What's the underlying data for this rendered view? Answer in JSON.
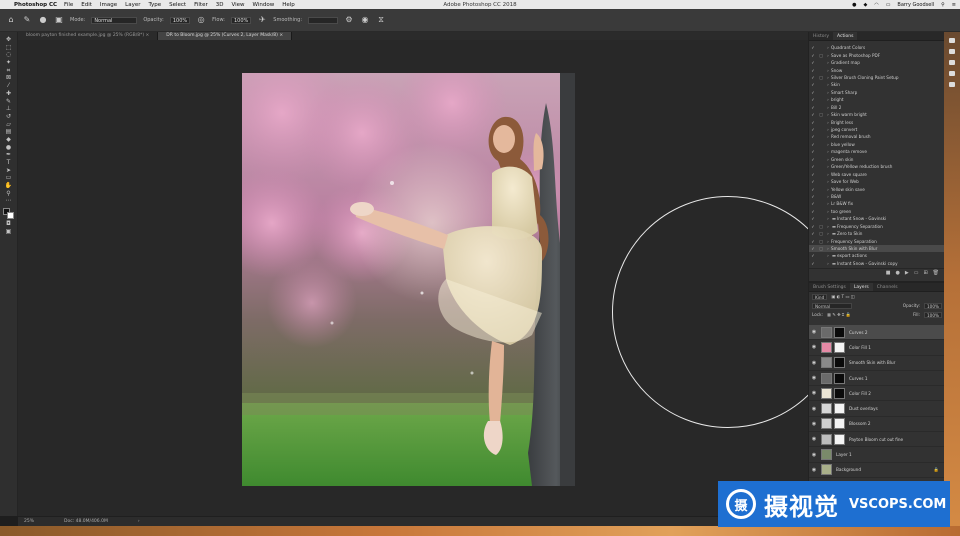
{
  "menubar": {
    "app": "Photoshop CC",
    "items": [
      "File",
      "Edit",
      "Image",
      "Layer",
      "Type",
      "Select",
      "Filter",
      "3D",
      "View",
      "Window",
      "Help"
    ],
    "window_title": "Adobe Photoshop CC 2018",
    "user": "Barry Goodsell"
  },
  "options": {
    "mode_label": "Mode:",
    "mode_value": "Normal",
    "opacity_label": "Opacity:",
    "opacity_value": "100%",
    "flow_label": "Flow:",
    "flow_value": "100%",
    "smoothing_label": "Smoothing:"
  },
  "tabs": [
    {
      "label": "bloom payton finished example.jpg @ 25% (RGB/8*) ×"
    },
    {
      "label": "DR to Bloom.jpg @ 25% (Curves 2, Layer Mask/8) ×"
    }
  ],
  "status": {
    "zoom": "25%",
    "doc": "Doc: 48.0M/406.0M"
  },
  "actions_panel": {
    "tabs": [
      "History",
      "Actions"
    ],
    "items": [
      {
        "label": "Quadrant Colors",
        "box": false,
        "folder": false
      },
      {
        "label": "Save as Photoshop PDF",
        "box": true,
        "folder": false
      },
      {
        "label": "Gradient map",
        "box": false,
        "folder": false
      },
      {
        "label": "Snow",
        "box": false,
        "folder": false
      },
      {
        "label": "Silver Brush Cloning Paint Setup",
        "box": true,
        "folder": false
      },
      {
        "label": "Skin",
        "box": false,
        "folder": false
      },
      {
        "label": "Smart Sharp",
        "box": false,
        "folder": false
      },
      {
        "label": "bright",
        "box": false,
        "folder": false
      },
      {
        "label": "Bill 2",
        "box": false,
        "folder": false
      },
      {
        "label": "Skin warm bright",
        "box": true,
        "folder": false
      },
      {
        "label": "Bright less",
        "box": false,
        "folder": false
      },
      {
        "label": "jpeg convert",
        "box": false,
        "folder": false
      },
      {
        "label": "Red removal brush",
        "box": false,
        "folder": false
      },
      {
        "label": "blue yellow",
        "box": false,
        "folder": false
      },
      {
        "label": "magenta remove",
        "box": false,
        "folder": false
      },
      {
        "label": "Green skin",
        "box": false,
        "folder": false
      },
      {
        "label": "Green/Yellow reduction brush",
        "box": false,
        "folder": false
      },
      {
        "label": "Web save square",
        "box": false,
        "folder": false
      },
      {
        "label": "Save for Web",
        "box": false,
        "folder": false
      },
      {
        "label": "Yellow skin save",
        "box": false,
        "folder": false
      },
      {
        "label": "B&W",
        "box": false,
        "folder": false
      },
      {
        "label": "Lr B&W fix",
        "box": false,
        "folder": false
      },
      {
        "label": "too green",
        "box": false,
        "folder": false
      },
      {
        "label": "Instant Snow - Gavinski",
        "box": false,
        "folder": true
      },
      {
        "label": "Frequency Separation",
        "box": true,
        "folder": true
      },
      {
        "label": "Zero to Skin",
        "box": true,
        "folder": true
      },
      {
        "label": "Frequency Separation",
        "box": true,
        "folder": false
      },
      {
        "label": "Smooth Skin with Blur",
        "box": true,
        "folder": false,
        "selected": true
      },
      {
        "label": "export actions",
        "box": false,
        "folder": true
      },
      {
        "label": "Instant Snow - Gavinski copy",
        "box": false,
        "folder": true
      }
    ]
  },
  "layers_panel": {
    "tabs": [
      "Brush Settings",
      "Layers",
      "Channels"
    ],
    "kind_label": "Kind",
    "blend_mode": "Normal",
    "opacity_label": "Opacity:",
    "opacity_value": "100%",
    "lock_label": "Lock:",
    "fill_label": "Fill:",
    "fill_value": "100%",
    "layers": [
      {
        "name": "Curves 2",
        "thumb": "#6a6a6a",
        "mask": "#0a0a0a",
        "selected": true
      },
      {
        "name": "Color Fill 1",
        "thumb": "#e58aa6",
        "mask": "#f4f4f4"
      },
      {
        "name": "Smooth Skin with Blur",
        "thumb": "#8a8a8a",
        "mask": "#0a0a0a"
      },
      {
        "name": "Curves 1",
        "thumb": "#6a6a6a",
        "mask": "#0a0a0a"
      },
      {
        "name": "Color Fill 2",
        "thumb": "#ece6d6",
        "mask": "#0a0a0a"
      },
      {
        "name": "Dust overlays",
        "thumb": "#d6d6d6",
        "mask": "#f4f4f4"
      },
      {
        "name": "Blossom 2",
        "thumb": "#cfcfcf",
        "mask": "#f4f4f4"
      },
      {
        "name": "Payton Bloom cut out fine",
        "thumb": "#bdbdbd",
        "mask": "#f4f4f4"
      },
      {
        "name": "Layer 1",
        "thumb": "#7a8a6a",
        "mask": null
      },
      {
        "name": "Background",
        "thumb": "#a9b08a",
        "mask": null,
        "locked": true
      }
    ]
  },
  "watermark": {
    "cn": "摄视觉",
    "en": "VSCOPS.COM"
  },
  "colors": {
    "accent": "#1e6fd1",
    "panel": "#323232",
    "canvas": "#282828"
  }
}
